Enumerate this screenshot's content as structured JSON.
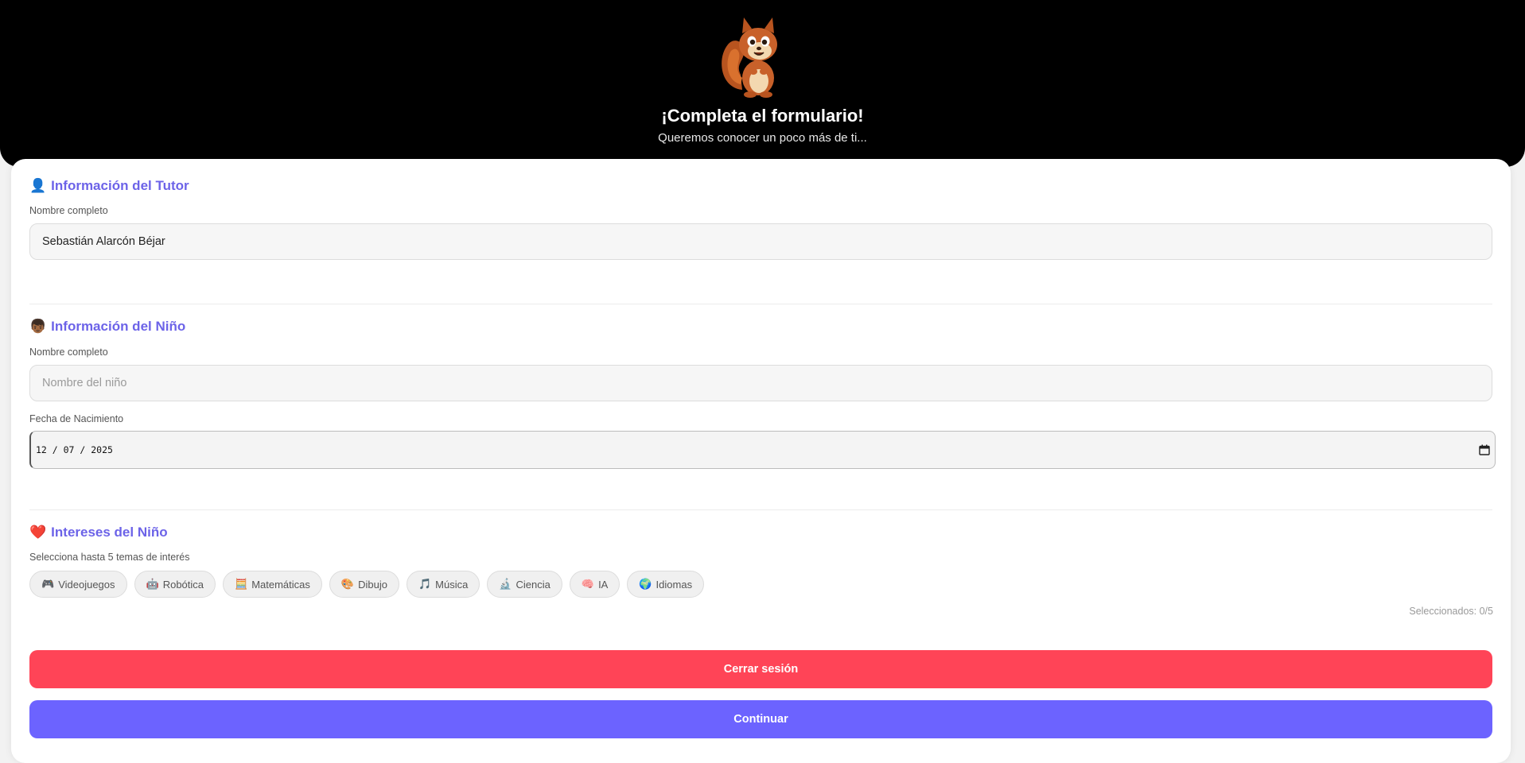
{
  "header": {
    "title": "¡Completa el formulario!",
    "subtitle": "Queremos conocer un poco más de ti..."
  },
  "tutor": {
    "icon": "person-icon",
    "icon_glyph": "👤",
    "title": "Información del Tutor",
    "name_label": "Nombre completo",
    "name_value": "Sebastián Alarcón Béjar"
  },
  "child": {
    "icon": "boy-icon",
    "icon_glyph": "👦🏾",
    "title": "Información del Niño",
    "name_label": "Nombre completo",
    "name_placeholder": "Nombre del niño",
    "name_value": "",
    "birth_label": "Fecha de Nacimiento",
    "birth_value": "12 / 07 / 2025"
  },
  "interests": {
    "icon": "heart-icon",
    "icon_glyph": "❤️",
    "title": "Intereses del Niño",
    "hint": "Selecciona hasta 5 temas de interés",
    "counter": "Seleccionados: 0/5",
    "options": [
      {
        "glyph": "🎮",
        "label": "Videojuegos"
      },
      {
        "glyph": "🤖",
        "label": "Robótica"
      },
      {
        "glyph": "🧮",
        "label": "Matemáticas"
      },
      {
        "glyph": "🎨",
        "label": "Dibujo"
      },
      {
        "glyph": "🎵",
        "label": "Música"
      },
      {
        "glyph": "🔬",
        "label": "Ciencia"
      },
      {
        "glyph": "🧠",
        "label": "IA"
      },
      {
        "glyph": "🌍",
        "label": "Idiomas"
      }
    ]
  },
  "actions": {
    "logout": "Cerrar sesión",
    "continue": "Continuar"
  },
  "colors": {
    "accent": "#6c63ff",
    "danger": "#ff4457",
    "header_bg": "#000000"
  }
}
